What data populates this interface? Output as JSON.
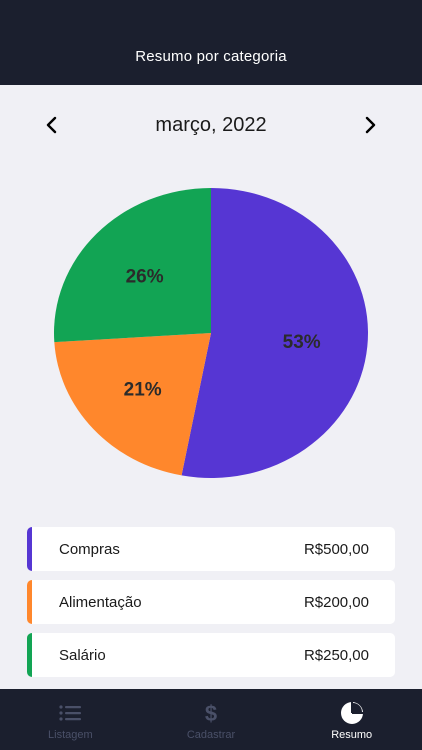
{
  "header": {
    "title": "Resumo por categoria"
  },
  "month_selector": {
    "label": "março, 2022",
    "prev_icon": "chevron-left-icon",
    "next_icon": "chevron-right-icon"
  },
  "chart_data": {
    "type": "pie",
    "categories": [
      "Compras",
      "Alimentação",
      "Salário"
    ],
    "values": [
      53,
      21,
      26
    ],
    "labels": [
      "53%",
      "21%",
      "26%"
    ],
    "colors": [
      "#5636d3",
      "#ff872c",
      "#12a454"
    ]
  },
  "legend": {
    "items": [
      {
        "name": "Compras",
        "amount": "R$500,00",
        "color": "#5636d3"
      },
      {
        "name": "Alimentação",
        "amount": "R$200,00",
        "color": "#ff872c"
      },
      {
        "name": "Salário",
        "amount": "R$250,00",
        "color": "#12a454"
      }
    ]
  },
  "tabbar": {
    "tabs": [
      {
        "label": "Listagem",
        "icon": "list-icon",
        "active": false
      },
      {
        "label": "Cadastrar",
        "icon": "dollar-icon",
        "active": false
      },
      {
        "label": "Resumo",
        "icon": "pie-chart-icon",
        "active": true
      }
    ]
  },
  "colors": {
    "header_bg": "#1b1f2e",
    "page_bg": "#f0f0f5",
    "inactive_tab": "#4a5068"
  }
}
